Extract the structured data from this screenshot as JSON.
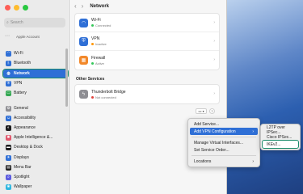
{
  "window": {
    "title": "Network"
  },
  "sidebar": {
    "search_placeholder": "Search",
    "account_label": "Apple Account",
    "items": [
      {
        "label": "Wi-Fi",
        "icon": "wifi-icon",
        "color": "#2f6fd6"
      },
      {
        "label": "Bluetooth",
        "icon": "bluetooth-icon",
        "color": "#2f6fd6"
      },
      {
        "label": "Network",
        "icon": "globe-icon",
        "color": "#2f6fd6",
        "active": true
      },
      {
        "label": "VPN",
        "icon": "vpn-icon",
        "color": "#2f6fd6"
      },
      {
        "label": "Battery",
        "icon": "battery-icon",
        "color": "#34a853"
      },
      {
        "label": "General",
        "icon": "gear-icon",
        "color": "#8e8e93"
      },
      {
        "label": "Accessibility",
        "icon": "accessibility-icon",
        "color": "#2f6fd6"
      },
      {
        "label": "Appearance",
        "icon": "appearance-icon",
        "color": "#1c1c1e"
      },
      {
        "label": "Apple Intelligence &...",
        "icon": "apple-intelligence-icon",
        "color": "#e0556b"
      },
      {
        "label": "Desktop & Dock",
        "icon": "dock-icon",
        "color": "#1c1c1e"
      },
      {
        "label": "Displays",
        "icon": "display-icon",
        "color": "#2f6fd6"
      },
      {
        "label": "Menu Bar",
        "icon": "menubar-icon",
        "color": "#1c1c1e"
      },
      {
        "label": "Spotlight",
        "icon": "spotlight-icon",
        "color": "#5c5ce0"
      },
      {
        "label": "Wallpaper",
        "icon": "wallpaper-icon",
        "color": "#2fb7e0"
      }
    ]
  },
  "main": {
    "services": [
      {
        "name": "Wi-Fi",
        "status": "Connected",
        "status_color": "#34c759",
        "icon": "wifi-icon",
        "color": "#2f6fd6"
      },
      {
        "name": "VPN",
        "status": "Inactive",
        "status_color": "#ff9500",
        "icon": "vpn-icon",
        "color": "#2f6fd6"
      },
      {
        "name": "Firewall",
        "status": "Active",
        "status_color": "#34c759",
        "icon": "firewall-icon",
        "color": "#f2882a"
      }
    ],
    "other_title": "Other Services",
    "other": [
      {
        "name": "Thunderbolt Bridge",
        "status": "Not connected",
        "status_color": "#e0403a",
        "icon": "thunderbolt-icon",
        "color": "#8e8e93"
      }
    ],
    "more_button": "••• ▾",
    "help_button": "?"
  },
  "menu": {
    "items": [
      {
        "label": "Add Service..."
      },
      {
        "label": "Add VPN Configuration",
        "submenu": true,
        "highlighted": true
      },
      {
        "separator": true
      },
      {
        "label": "Manage Virtual Interfaces..."
      },
      {
        "label": "Set Service Order..."
      },
      {
        "separator": true
      },
      {
        "label": "Locations",
        "submenu": true
      }
    ]
  },
  "submenu": {
    "items": [
      {
        "label": "L2TP over IPSec..."
      },
      {
        "label": "Cisco IPSec..."
      },
      {
        "label": "IKEv2..."
      }
    ]
  }
}
